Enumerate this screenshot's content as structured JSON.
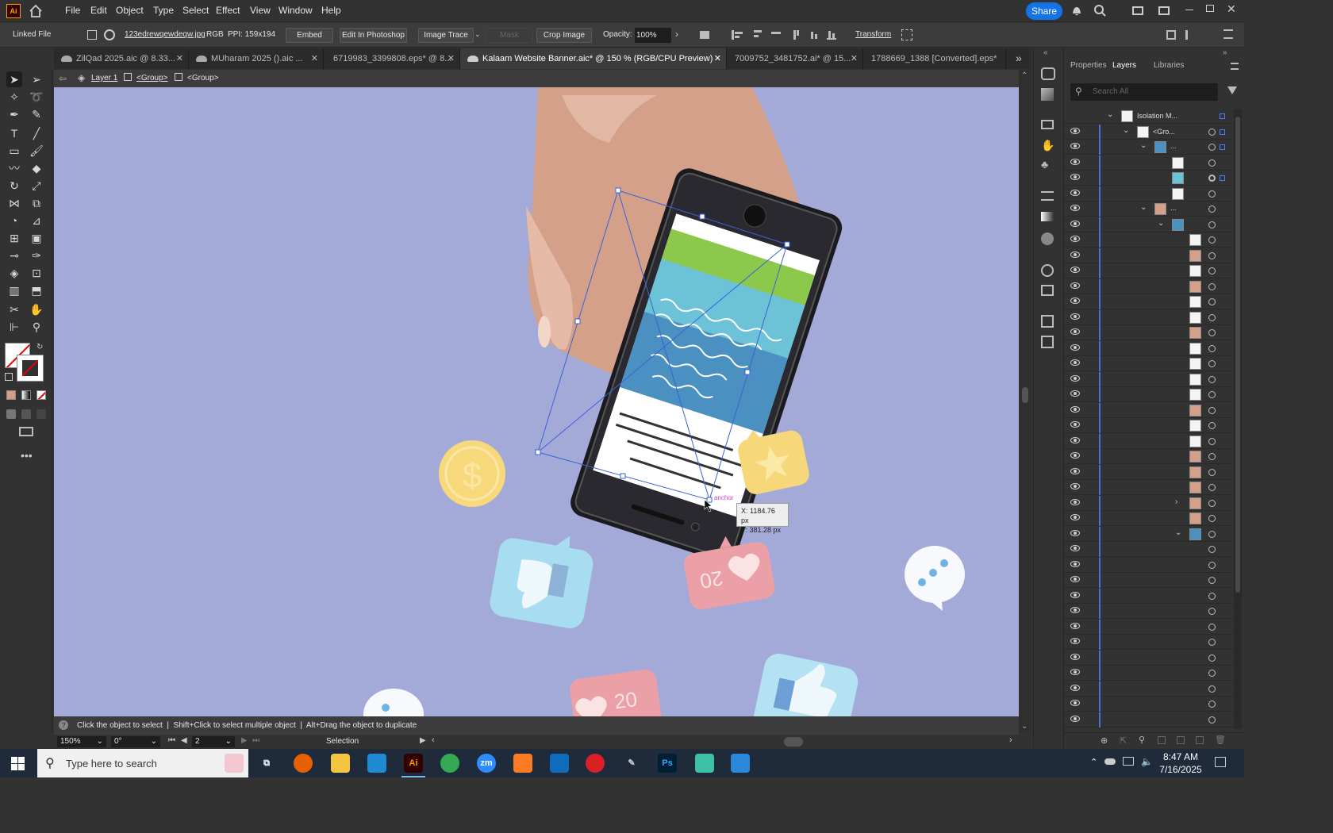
{
  "app": {
    "logo": "Ai",
    "share_label": "Share"
  },
  "menu": [
    "File",
    "Edit",
    "Object",
    "Type",
    "Select",
    "Effect",
    "View",
    "Window",
    "Help"
  ],
  "control": {
    "linked_file": "Linked File",
    "filename": "123edrewqewdeqw.jpg",
    "color_mode": "RGB",
    "ppi": "PPI: 159x194",
    "embed": "Embed",
    "edit_ps": "Edit In Photoshop",
    "image_trace": "Image Trace",
    "mask": "Mask",
    "crop": "Crop Image",
    "opacity_label": "Opacity:",
    "opacity_value": "100%",
    "transform": "Transform"
  },
  "tabs": [
    {
      "label": "ZilQad 2025.aic @ 8.33...",
      "active": false
    },
    {
      "label": "MUharam 2025 ().aic ...",
      "active": false
    },
    {
      "label": "6719983_3399808.eps* @ 8...",
      "active": false
    },
    {
      "label": "Kalaam Website Banner.aic* @ 150 % (RGB/CPU Preview)",
      "active": true
    },
    {
      "label": "7009752_3481752.ai* @ 15...",
      "active": false
    },
    {
      "label": "1788669_1388 [Converted].eps*",
      "active": false
    }
  ],
  "breadcrumb": {
    "layer": "Layer 1",
    "group1": "<Group>",
    "group2": "<Group>"
  },
  "canvas": {
    "tooltip_x": "X: 1184.76 px",
    "tooltip_y": "Y: 381.28 px",
    "anchor_label": "anchor",
    "like_count": "20",
    "heart_count": "20",
    "bg_color": "#a4aad8"
  },
  "status": {
    "hint": "Click the object to select  |  Shift+Click to select multiple object  |  Alt+Drag the object to duplicate",
    "zoom": "150%",
    "rotation": "0°",
    "artboard": "2",
    "tool": "Selection"
  },
  "panel": {
    "tabs": [
      "Properties",
      "Layers",
      "Libraries"
    ],
    "search_placeholder": "Search All",
    "isolation": "Isolation M...",
    "group_label": "<Gro...",
    "sub1": "...",
    "sub2": "..."
  },
  "layers_count": 40,
  "taskbar": {
    "search_placeholder": "Type here to search",
    "time": "8:47 AM",
    "date": "7/16/2025"
  }
}
